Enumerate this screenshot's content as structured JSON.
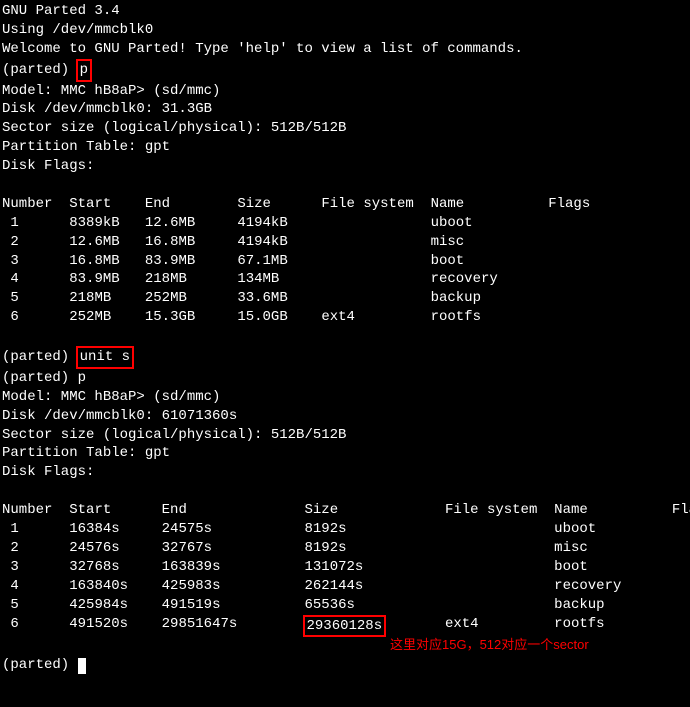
{
  "header": {
    "app_title": "GNU Parted 3.4",
    "using_line": "Using /dev/mmcblk0",
    "welcome": "Welcome to GNU Parted! Type 'help' to view a list of commands."
  },
  "session1": {
    "prompt": "(parted) ",
    "cmd": "p",
    "model": "Model: MMC hB8aP> (sd/mmc)",
    "disk": "Disk /dev/mmcblk0: 31.3GB",
    "sector_size": "Sector size (logical/physical): 512B/512B",
    "ptable": "Partition Table: gpt",
    "dflags": "Disk Flags:",
    "cols": {
      "number": "Number",
      "start": "Start",
      "end": "End",
      "size": "Size",
      "fs": "File system",
      "name": "Name",
      "flags": "Flags"
    },
    "rows": [
      {
        "num": "1",
        "start": "8389kB",
        "end": "12.6MB",
        "size": "4194kB",
        "fs": "",
        "name": "uboot"
      },
      {
        "num": "2",
        "start": "12.6MB",
        "end": "16.8MB",
        "size": "4194kB",
        "fs": "",
        "name": "misc"
      },
      {
        "num": "3",
        "start": "16.8MB",
        "end": "83.9MB",
        "size": "67.1MB",
        "fs": "",
        "name": "boot"
      },
      {
        "num": "4",
        "start": "83.9MB",
        "end": "218MB",
        "size": "134MB",
        "fs": "",
        "name": "recovery"
      },
      {
        "num": "5",
        "start": "218MB",
        "end": "252MB",
        "size": "33.6MB",
        "fs": "",
        "name": "backup"
      },
      {
        "num": "6",
        "start": "252MB",
        "end": "15.3GB",
        "size": "15.0GB",
        "fs": "ext4",
        "name": "rootfs"
      }
    ]
  },
  "session2": {
    "prompt": "(parted) ",
    "cmd1": "unit s",
    "cmd2": "p",
    "model": "Model: MMC hB8aP> (sd/mmc)",
    "disk": "Disk /dev/mmcblk0: 61071360s",
    "sector_size": "Sector size (logical/physical): 512B/512B",
    "ptable": "Partition Table: gpt",
    "dflags": "Disk Flags:",
    "cols": {
      "number": "Number",
      "start": "Start",
      "end": "End",
      "size": "Size",
      "fs": "File system",
      "name": "Name",
      "flags": "Flags"
    },
    "rows": [
      {
        "num": "1",
        "start": "16384s",
        "end": "24575s",
        "size": "8192s",
        "fs": "",
        "name": "uboot"
      },
      {
        "num": "2",
        "start": "24576s",
        "end": "32767s",
        "size": "8192s",
        "fs": "",
        "name": "misc"
      },
      {
        "num": "3",
        "start": "32768s",
        "end": "163839s",
        "size": "131072s",
        "fs": "",
        "name": "boot"
      },
      {
        "num": "4",
        "start": "163840s",
        "end": "425983s",
        "size": "262144s",
        "fs": "",
        "name": "recovery"
      },
      {
        "num": "5",
        "start": "425984s",
        "end": "491519s",
        "size": "65536s",
        "fs": "",
        "name": "backup"
      },
      {
        "num": "6",
        "start": "491520s",
        "end": "29851647s",
        "size": "29360128s",
        "fs": "ext4",
        "name": "rootfs"
      }
    ]
  },
  "final_prompt": "(parted) ",
  "annotation": "这里对应15G，512对应一个sector"
}
